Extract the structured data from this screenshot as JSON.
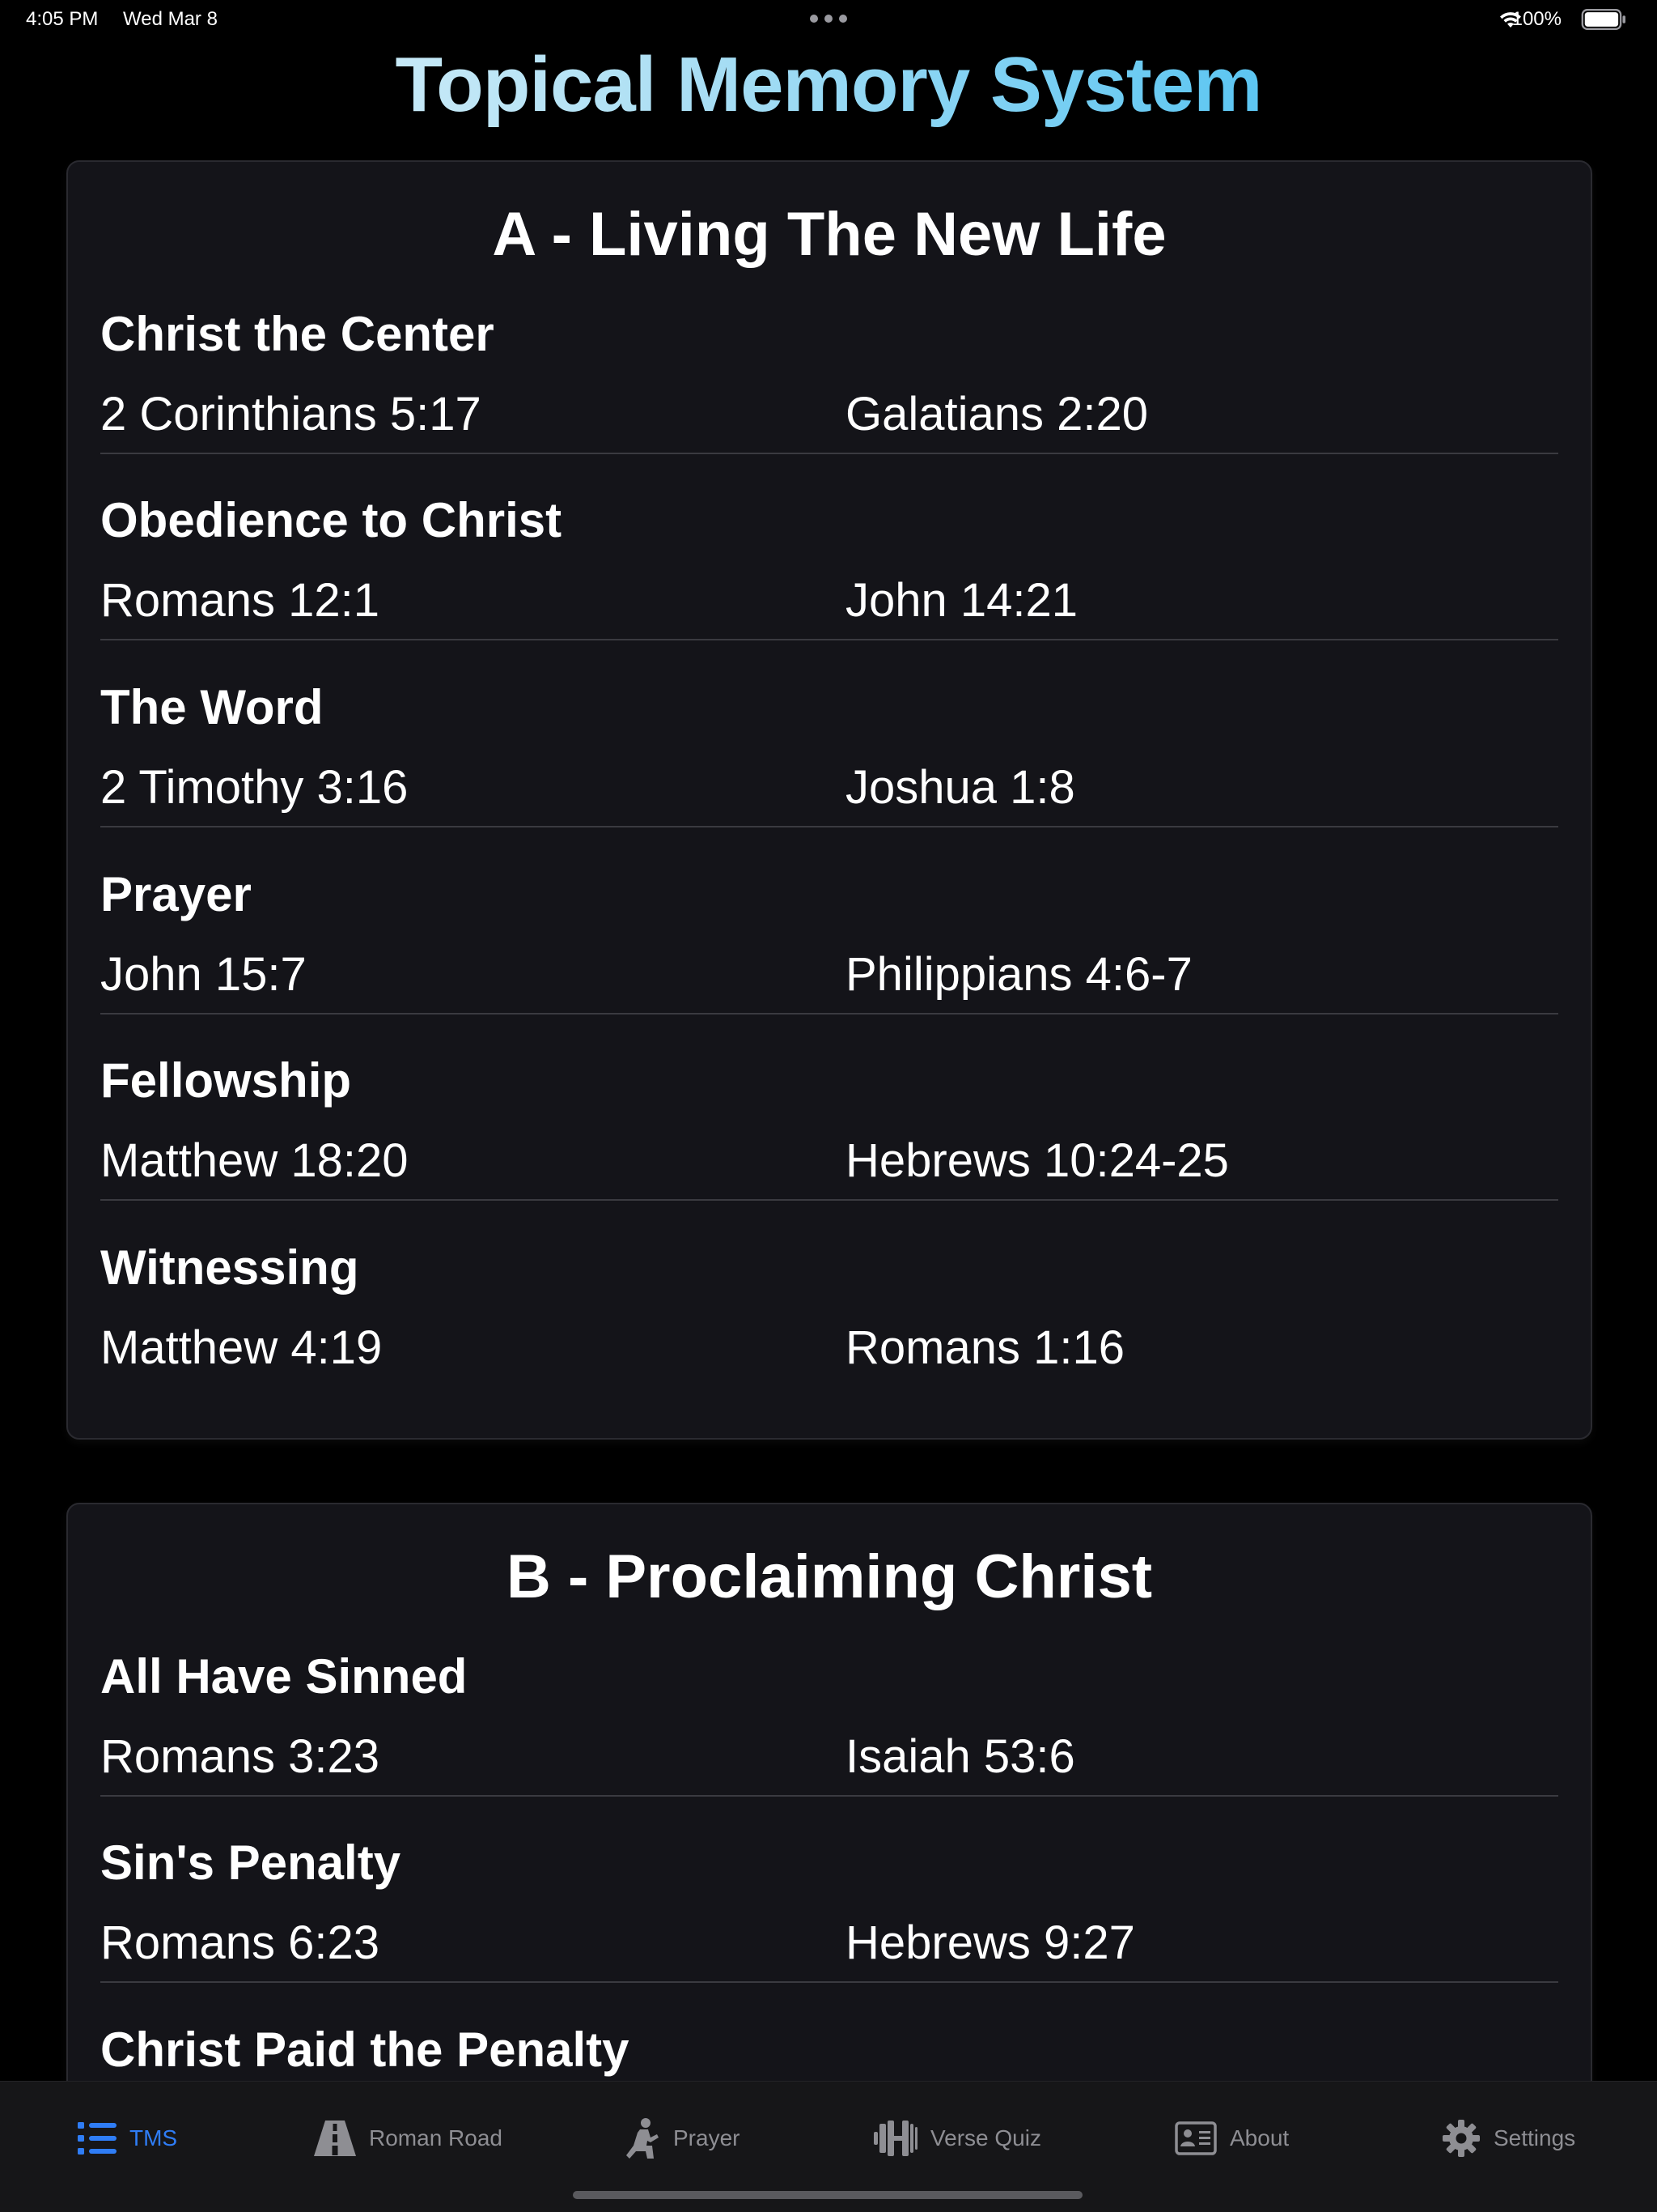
{
  "status_bar": {
    "time": "4:05 PM",
    "date": "Wed Mar 8",
    "battery": "100%"
  },
  "app": {
    "title": "Topical Memory System",
    "title_gradient": [
      "#eaf6fc",
      "#3fb6ee"
    ]
  },
  "sections": [
    {
      "title": "A - Living The New Life",
      "topics": [
        {
          "title": "Christ the Center",
          "verses": [
            "2 Corinthians 5:17",
            "Galatians 2:20"
          ]
        },
        {
          "title": "Obedience to Christ",
          "verses": [
            "Romans 12:1",
            "John 14:21"
          ]
        },
        {
          "title": "The Word",
          "verses": [
            "2 Timothy 3:16",
            "Joshua 1:8"
          ]
        },
        {
          "title": "Prayer",
          "verses": [
            "John 15:7",
            "Philippians 4:6-7"
          ]
        },
        {
          "title": "Fellowship",
          "verses": [
            "Matthew 18:20",
            "Hebrews 10:24-25"
          ]
        },
        {
          "title": "Witnessing",
          "verses": [
            "Matthew 4:19",
            "Romans 1:16"
          ]
        }
      ]
    },
    {
      "title": "B - Proclaiming Christ",
      "topics": [
        {
          "title": "All Have Sinned",
          "verses": [
            "Romans 3:23",
            "Isaiah 53:6"
          ]
        },
        {
          "title": "Sin's Penalty",
          "verses": [
            "Romans 6:23",
            "Hebrews 9:27"
          ]
        },
        {
          "title": "Christ Paid the Penalty",
          "verses": []
        }
      ]
    }
  ],
  "tab_bar": {
    "active_color": "#2f7df6",
    "inactive_color": "#8e8e93",
    "tabs": [
      {
        "label": "TMS",
        "icon": "list-icon",
        "active": true
      },
      {
        "label": "Roman Road",
        "icon": "road-icon",
        "active": false
      },
      {
        "label": "Prayer",
        "icon": "kneeling-person-icon",
        "active": false
      },
      {
        "label": "Verse Quiz",
        "icon": "dumbbell-icon",
        "active": false
      },
      {
        "label": "About",
        "icon": "contact-card-icon",
        "active": false
      },
      {
        "label": "Settings",
        "icon": "gear-icon",
        "active": false
      }
    ]
  }
}
